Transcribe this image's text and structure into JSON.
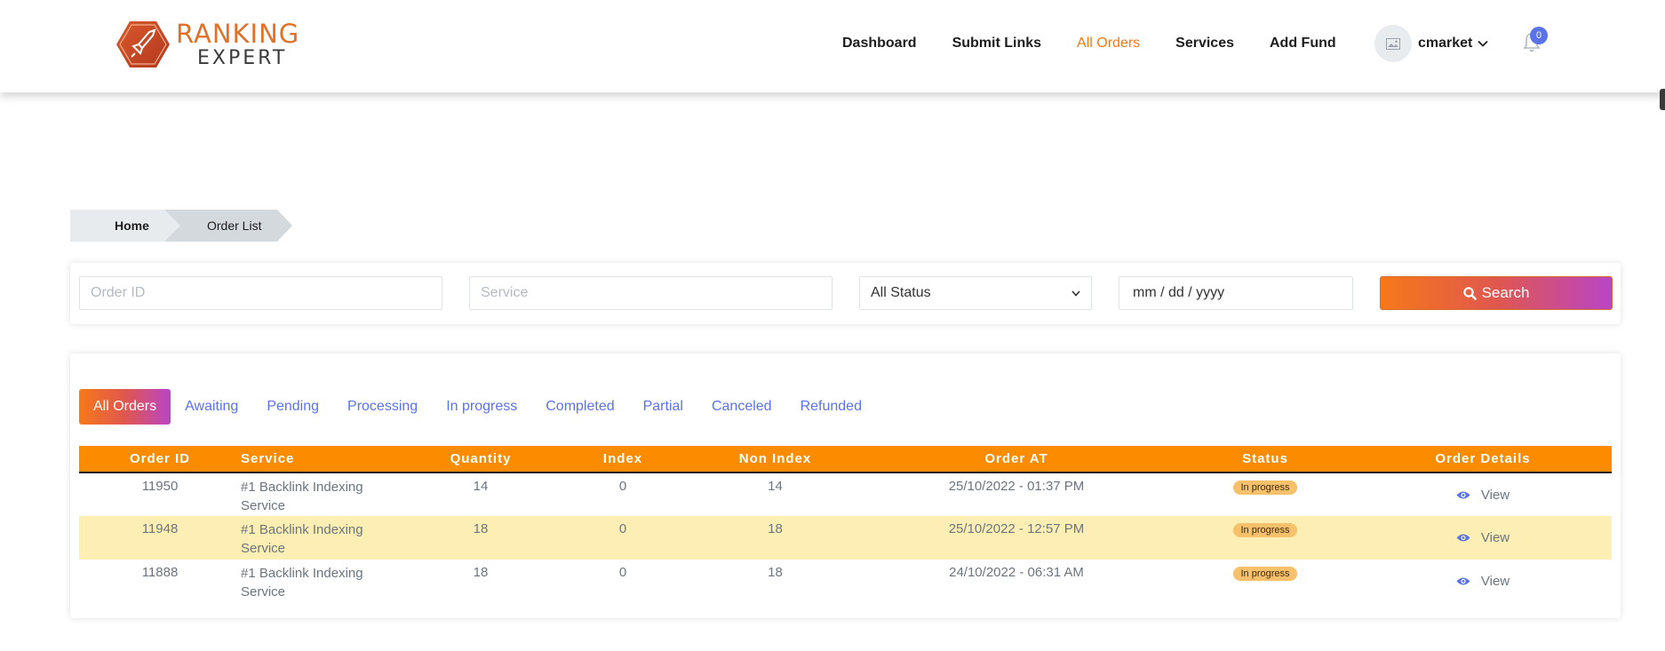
{
  "brand": {
    "line1": "RANKING",
    "line2": "EXPERT"
  },
  "nav": [
    {
      "label": "Dashboard",
      "active": false
    },
    {
      "label": "Submit Links",
      "active": false
    },
    {
      "label": "All Orders",
      "active": true
    },
    {
      "label": "Services",
      "active": false
    },
    {
      "label": "Add Fund",
      "active": false
    }
  ],
  "user": {
    "name": "cmarket",
    "notifications": "0"
  },
  "breadcrumb": {
    "home": "Home",
    "current": "Order List"
  },
  "filters": {
    "order_id_placeholder": "Order ID",
    "service_placeholder": "Service",
    "status_selected": "All Status",
    "date_placeholder": "mm / dd / yyyy",
    "search_label": "Search"
  },
  "tabs": [
    "All Orders",
    "Awaiting",
    "Pending",
    "Processing",
    "In progress",
    "Completed",
    "Partial",
    "Canceled",
    "Refunded"
  ],
  "table": {
    "columns": [
      "Order ID",
      "Service",
      "Quantity",
      "Index",
      "Non Index",
      "Order AT",
      "Status",
      "Order Details"
    ],
    "rows": [
      {
        "order_id": "11950",
        "service": "#1 Backlink Indexing Service",
        "quantity": "14",
        "index": "0",
        "non_index": "14",
        "order_at": "25/10/2022 - 01:37 PM",
        "status": "In progress",
        "details": "View"
      },
      {
        "order_id": "11948",
        "service": "#1 Backlink Indexing Service",
        "quantity": "18",
        "index": "0",
        "non_index": "18",
        "order_at": "25/10/2022 - 12:57 PM",
        "status": "In progress",
        "details": "View"
      },
      {
        "order_id": "11888",
        "service": "#1 Backlink Indexing Service",
        "quantity": "18",
        "index": "0",
        "non_index": "18",
        "order_at": "24/10/2022 - 06:31 AM",
        "status": "In progress",
        "details": "View"
      }
    ]
  },
  "colors": {
    "accent": "#f07b16",
    "table_header": "#fb8c00",
    "link": "#5b73e8",
    "alt_row": "#fdefb4",
    "status_badge": "#f6c16a"
  }
}
